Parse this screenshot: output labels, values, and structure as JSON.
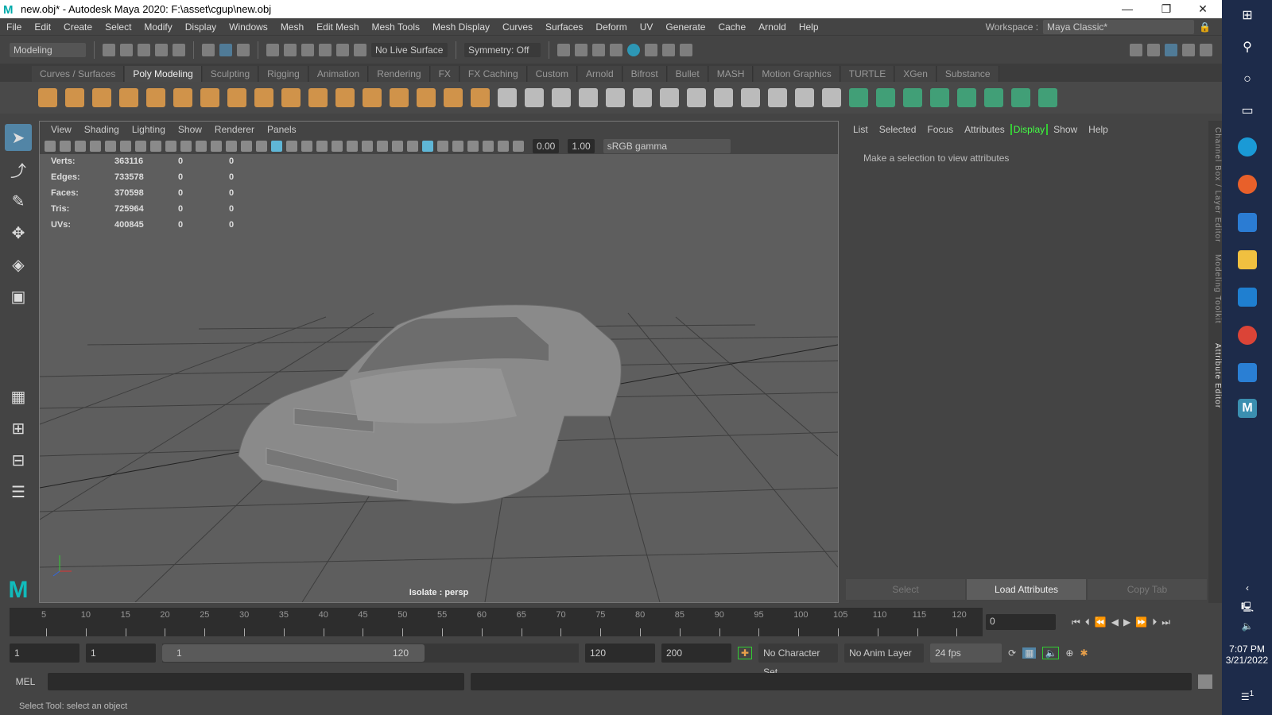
{
  "title": "new.obj* - Autodesk Maya 2020: F:\\asset\\cgup\\new.obj",
  "window_buttons": {
    "minimize": "—",
    "maximize": "❐",
    "close": "✕"
  },
  "menu": [
    "File",
    "Edit",
    "Create",
    "Select",
    "Modify",
    "Display",
    "Windows",
    "Mesh",
    "Edit Mesh",
    "Mesh Tools",
    "Mesh Display",
    "Curves",
    "Surfaces",
    "Deform",
    "UV",
    "Generate",
    "Cache",
    "Arnold",
    "Help"
  ],
  "workspace": {
    "label": "Workspace :",
    "value": "Maya Classic*"
  },
  "toolbar": {
    "mode": "Modeling",
    "live_surface": "No Live Surface",
    "symmetry": "Symmetry: Off"
  },
  "shelf_tabs": [
    "Curves / Surfaces",
    "Poly Modeling",
    "Sculpting",
    "Rigging",
    "Animation",
    "Rendering",
    "FX",
    "FX Caching",
    "Custom",
    "Arnold",
    "Bifrost",
    "Bullet",
    "MASH",
    "Motion Graphics",
    "TURTLE",
    "XGen",
    "Substance"
  ],
  "active_shelf_tab": "Poly Modeling",
  "viewport": {
    "menu": [
      "View",
      "Shading",
      "Lighting",
      "Show",
      "Renderer",
      "Panels"
    ],
    "exposure": "0.00",
    "gamma": "1.00",
    "color_space": "sRGB gamma",
    "hud": [
      [
        "Verts:",
        "363116",
        "0",
        "0"
      ],
      [
        "Edges:",
        "733578",
        "0",
        "0"
      ],
      [
        "Faces:",
        "370598",
        "0",
        "0"
      ],
      [
        "Tris:",
        "725964",
        "0",
        "0"
      ],
      [
        "UVs:",
        "400845",
        "0",
        "0"
      ]
    ],
    "camera_label": "Isolate : persp"
  },
  "attribute_editor": {
    "menu": [
      "List",
      "Selected",
      "Focus",
      "Attributes",
      "Display",
      "Show",
      "Help"
    ],
    "highlighted": "Display",
    "message": "Make a selection to view attributes",
    "buttons": [
      "Select",
      "Load Attributes",
      "Copy Tab"
    ]
  },
  "side_tabs": [
    "Channel Box / Layer Editor",
    "Modeling Toolkit",
    "Attribute Editor"
  ],
  "timeline": {
    "ticks": [
      "5",
      "10",
      "15",
      "20",
      "25",
      "30",
      "35",
      "40",
      "45",
      "50",
      "55",
      "60",
      "65",
      "70",
      "75",
      "80",
      "85",
      "90",
      "95",
      "100",
      "105",
      "110",
      "115",
      "120"
    ],
    "current_frame": "0"
  },
  "range": {
    "start": "1",
    "playback_start": "1",
    "slider_start": "1",
    "slider_end": "120",
    "playback_end": "120",
    "end": "200",
    "character_set": "No Character Set",
    "anim_layer": "No Anim Layer",
    "fps": "24 fps"
  },
  "command": {
    "label": "MEL"
  },
  "help_line": "Select Tool: select an object",
  "taskbar": {
    "time": "7:07 PM",
    "date": "3/21/2022",
    "notifications": "1"
  },
  "colors": {
    "accent": "#5285a6",
    "orange": "#e8a04a",
    "highlight_green": "#3c3"
  }
}
